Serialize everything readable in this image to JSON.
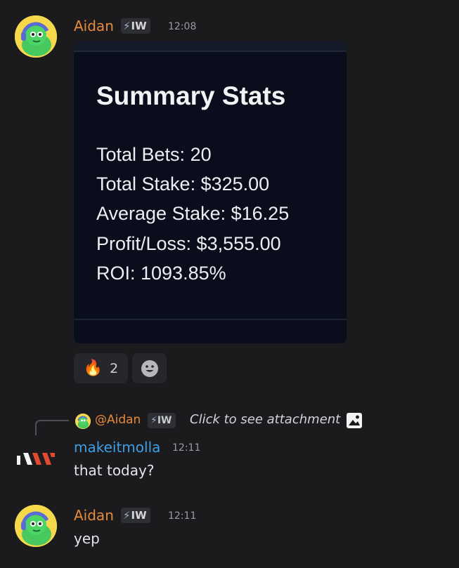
{
  "messages": [
    {
      "author": "Aidan",
      "tag": "IW",
      "time": "12:08",
      "card": {
        "title": "Summary Stats",
        "lines": [
          "Total Bets: 20",
          "Total Stake: $325.00",
          "Average Stake: $16.25",
          "Profit/Loss: $3,555.00",
          "ROI: 1093.85%"
        ]
      },
      "reactions": [
        {
          "emoji": "🔥",
          "count": "2"
        }
      ]
    },
    {
      "reply": {
        "mention": "@Aidan",
        "tag": "IW",
        "text": "Click to see attachment"
      },
      "author": "makeitmolla",
      "time": "12:11",
      "text": "that today?"
    },
    {
      "author": "Aidan",
      "tag": "IW",
      "time": "12:11",
      "text": "yep"
    }
  ],
  "colors": {
    "background": "#1b1b1e",
    "author_orange": "#e78a3a",
    "author_blue": "#3d9ee6",
    "card_bg": "#0a0d1c"
  },
  "icons": {
    "tag_icon": "lightning-bolt",
    "add_reaction": "smiley-face",
    "attachment": "image-icon"
  }
}
